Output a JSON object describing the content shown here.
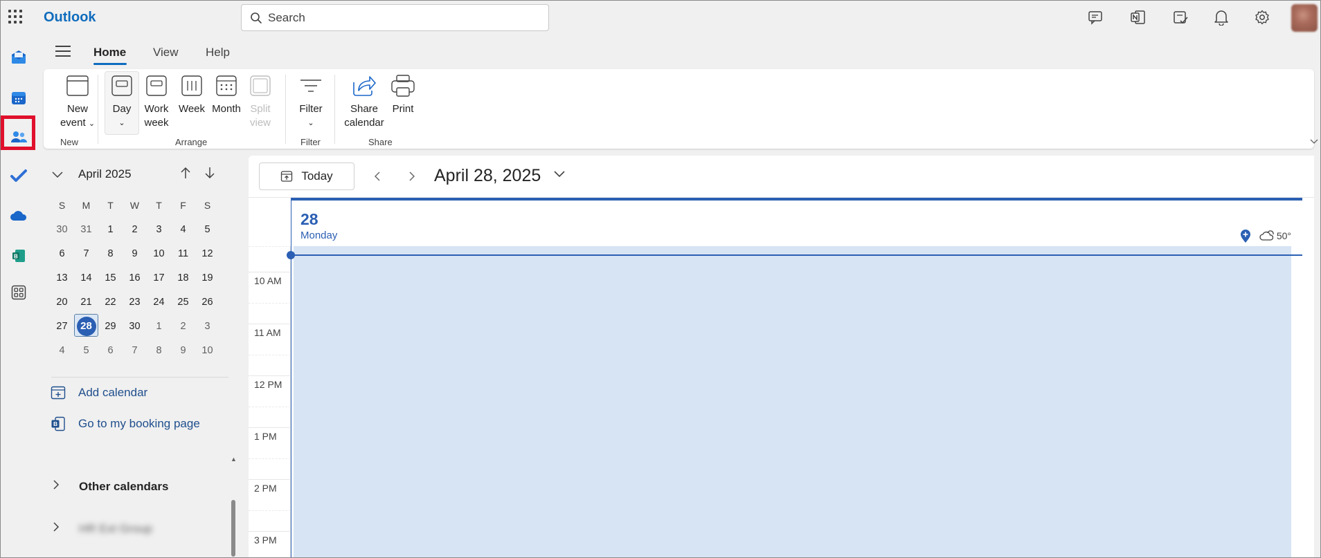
{
  "app": {
    "title": "Outlook"
  },
  "search": {
    "placeholder": "Search"
  },
  "topbar_icons": [
    "chat-icon",
    "onenote-icon",
    "todo-icon",
    "bell-icon",
    "gear-icon"
  ],
  "rail": [
    "mail",
    "calendar",
    "people",
    "todo",
    "onedrive",
    "bookings",
    "more-apps"
  ],
  "tabs": [
    {
      "label": "Home",
      "active": true
    },
    {
      "label": "View",
      "active": false
    },
    {
      "label": "Help",
      "active": false
    }
  ],
  "ribbon": {
    "new_event_line1": "New",
    "new_event_line2": "event",
    "day": "Day",
    "work_week_line1": "Work",
    "work_week_line2": "week",
    "week": "Week",
    "month": "Month",
    "split_view_line1": "Split",
    "split_view_line2": "view",
    "filter": "Filter",
    "share_line1": "Share",
    "share_line2": "calendar",
    "print": "Print",
    "groups": {
      "new": "New",
      "arrange": "Arrange",
      "filter": "Filter",
      "share": "Share"
    }
  },
  "mini_calendar": {
    "title": "April 2025",
    "weekdays": [
      "S",
      "M",
      "T",
      "W",
      "T",
      "F",
      "S"
    ],
    "weeks": [
      [
        "30",
        "31",
        "1",
        "2",
        "3",
        "4",
        "5"
      ],
      [
        "6",
        "7",
        "8",
        "9",
        "10",
        "11",
        "12"
      ],
      [
        "13",
        "14",
        "15",
        "16",
        "17",
        "18",
        "19"
      ],
      [
        "20",
        "21",
        "22",
        "23",
        "24",
        "25",
        "26"
      ],
      [
        "27",
        "28",
        "29",
        "30",
        "1",
        "2",
        "3"
      ],
      [
        "4",
        "5",
        "6",
        "7",
        "8",
        "9",
        "10"
      ]
    ],
    "selected": "28"
  },
  "nav": {
    "add_calendar": "Add calendar",
    "booking_page": "Go to my booking page",
    "other_calendars": "Other calendars",
    "group_blurred": "HR Ext Group"
  },
  "main": {
    "today_label": "Today",
    "date_title": "April 28, 2025",
    "day_number": "28",
    "day_name": "Monday",
    "weather_temp": "50°",
    "times": [
      "10 AM",
      "11 AM",
      "12 PM",
      "1 PM",
      "2 PM",
      "3 PM"
    ]
  },
  "colors": {
    "accent": "#0f6cbd",
    "selected_day": "#2b5fb3",
    "day_fill": "#d7e4f4",
    "highlight": "#e0102c"
  }
}
